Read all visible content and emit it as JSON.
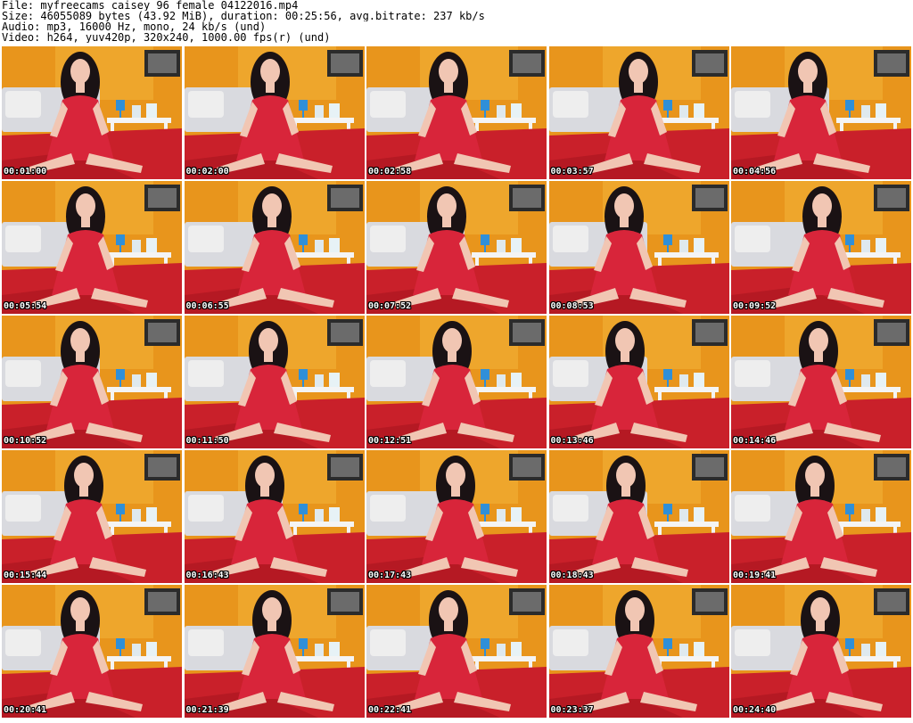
{
  "info": {
    "lines": [
      "File: myfreecams_caisey_96_female_04122016.mp4",
      "Size: 46055089 bytes (43.92 MiB), duration: 00:25:56, avg.bitrate: 237 kb/s",
      "Audio: mp3, 16000 Hz, mono, 24 kb/s (und)",
      "Video: h264, yuv420p, 320x240, 1000.00 fps(r) (und)"
    ]
  },
  "thumbnails": [
    {
      "timestamp": "00:01:00"
    },
    {
      "timestamp": "00:02:00"
    },
    {
      "timestamp": "00:02:58"
    },
    {
      "timestamp": "00:03:57"
    },
    {
      "timestamp": "00:04:56"
    },
    {
      "timestamp": "00:05:54"
    },
    {
      "timestamp": "00:06:55"
    },
    {
      "timestamp": "00:07:52"
    },
    {
      "timestamp": "00:08:53"
    },
    {
      "timestamp": "00:09:52"
    },
    {
      "timestamp": "00:10:52"
    },
    {
      "timestamp": "00:11:50"
    },
    {
      "timestamp": "00:12:51"
    },
    {
      "timestamp": "00:13:46"
    },
    {
      "timestamp": "00:14:46"
    },
    {
      "timestamp": "00:15:44"
    },
    {
      "timestamp": "00:16:43"
    },
    {
      "timestamp": "00:17:43"
    },
    {
      "timestamp": "00:18:43"
    },
    {
      "timestamp": "00:19:41"
    },
    {
      "timestamp": "00:20:41"
    },
    {
      "timestamp": "00:21:39"
    },
    {
      "timestamp": "00:22:41"
    },
    {
      "timestamp": "00:23:37"
    },
    {
      "timestamp": "00:24:40"
    }
  ],
  "colors": {
    "wall": "#e8951c",
    "wall_light": "#f2b53a",
    "bed": "#d9dadf",
    "pillow": "#eeeeee",
    "blanket": "#c9202a",
    "table": "#f4f4f4",
    "lamp": "#2f8fd8",
    "dress": "#d8253a",
    "hair": "#1a1214",
    "skin": "#f1c6b3",
    "frame": "#2b2b2b"
  }
}
